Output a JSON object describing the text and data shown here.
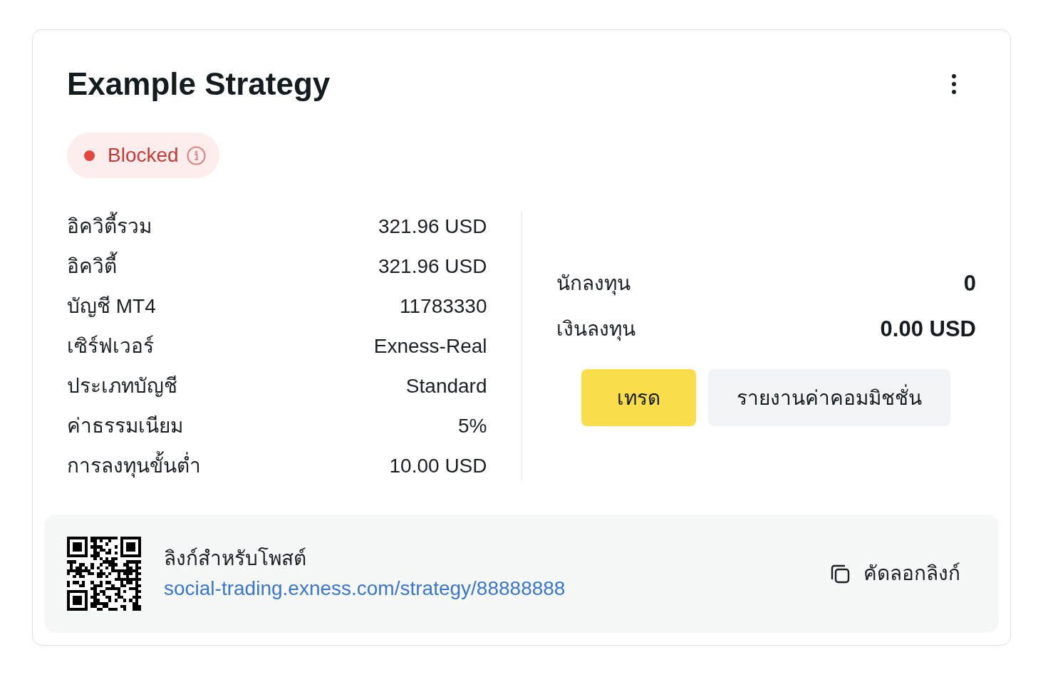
{
  "card": {
    "title": "Example Strategy",
    "status": {
      "label": "Blocked",
      "kind": "blocked"
    },
    "details": [
      {
        "label": "อิควิตี้รวม",
        "value": "321.96 USD"
      },
      {
        "label": "อิควิตี้",
        "value": "321.96 USD"
      },
      {
        "label": "บัญชี MT4",
        "value": "11783330"
      },
      {
        "label": "เซิร์ฟเวอร์",
        "value": "Exness-Real"
      },
      {
        "label": "ประเภทบัญชี",
        "value": "Standard"
      },
      {
        "label": "ค่าธรรมเนียม",
        "value": "5%"
      },
      {
        "label": "การลงทุนขั้นต่ำ",
        "value": "10.00 USD"
      }
    ],
    "summary": [
      {
        "label": "นักลงทุน",
        "value": "0"
      },
      {
        "label": "เงินลงทุน",
        "value": "0.00 USD"
      }
    ],
    "actions": [
      {
        "label": "เทรด",
        "kind": "primary"
      },
      {
        "label": "รายงานค่าคอมมิชชั่น",
        "kind": "secondary"
      }
    ],
    "share": {
      "title": "ลิงก์สำหรับโพสต์",
      "link": "social-trading.exness.com/strategy/88888888",
      "copy_label": "คัดลอกลิงก์"
    }
  }
}
